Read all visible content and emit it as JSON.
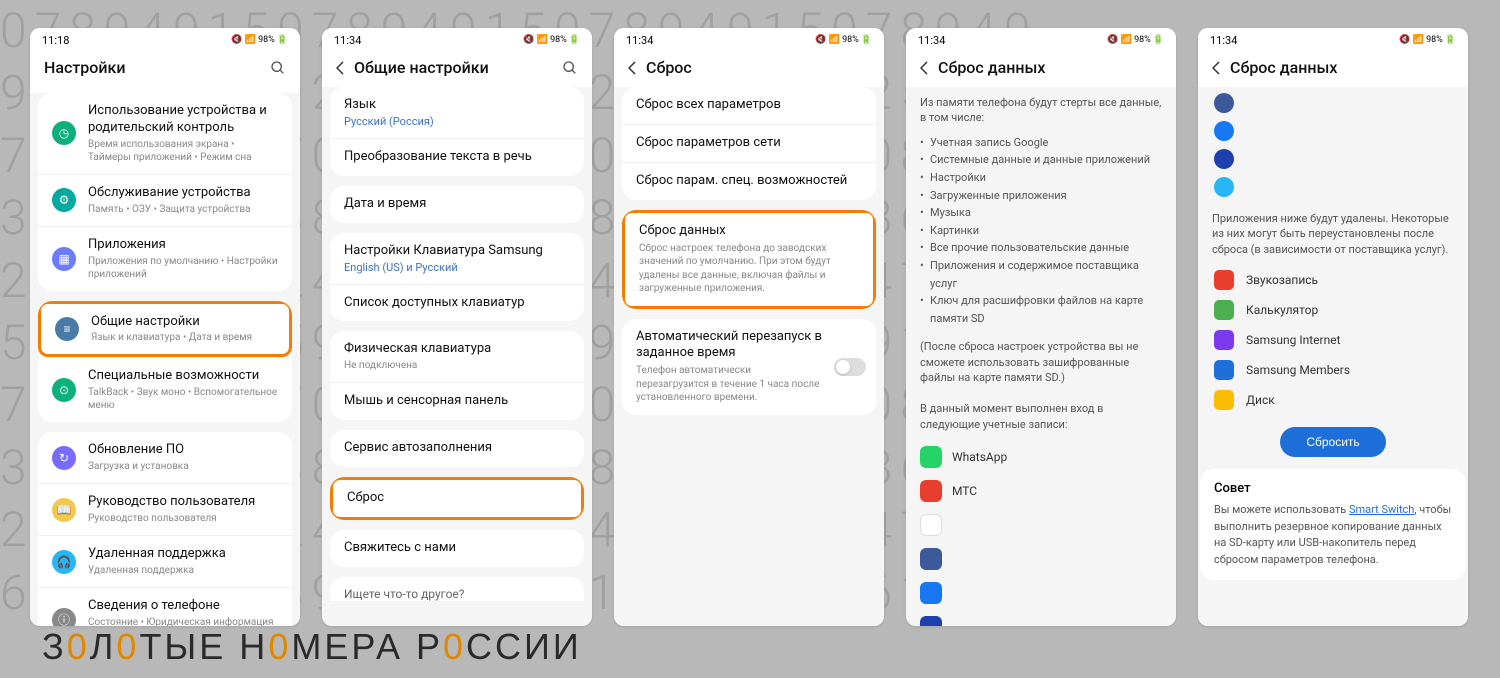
{
  "bg": "0 7 8 9 4 Q 1 5\n9 2 5 7 4 3\n7 0 8 4 2 1\n3 8 6 1 9 5\n2 4 7 0 3 8\n5 9 1 6 2 4",
  "brand": "ЗОЛОТЫЕ НОМЕРА РОССИИ",
  "screen1": {
    "time": "11:18",
    "battery": "98%",
    "title": "Настройки",
    "items": [
      {
        "icon_bg": "#0bb07b",
        "glyph": "◷",
        "title": "Использование устройства и родительский контроль",
        "sub": "Время использования экрана • Таймеры приложений • Режим сна"
      },
      {
        "icon_bg": "#00a99d",
        "glyph": "⚙",
        "title": "Обслуживание устройства",
        "sub": "Память • ОЗУ • Защита устройства"
      },
      {
        "icon_bg": "#6b7cff",
        "glyph": "▦",
        "title": "Приложения",
        "sub": "Приложения по умолчанию • Настройки приложений"
      },
      {
        "icon_bg": "#4a7ba6",
        "glyph": "≡",
        "title": "Общие настройки",
        "sub": "Язык и клавиатура • Дата и время",
        "hl": true
      },
      {
        "icon_bg": "#0bb07b",
        "glyph": "⊙",
        "title": "Специальные возможности",
        "sub": "TalkBack • Звук моно • Вспомогательное меню"
      },
      {
        "icon_bg": "#7a6bff",
        "glyph": "↻",
        "title": "Обновление ПО",
        "sub": "Загрузка и установка"
      },
      {
        "icon_bg": "#f2c94c",
        "glyph": "📖",
        "title": "Руководство пользователя",
        "sub": "Руководство пользователя"
      },
      {
        "icon_bg": "#29b6f6",
        "glyph": "🎧",
        "title": "Удаленная поддержка",
        "sub": "Удаленная поддержка"
      },
      {
        "icon_bg": "#888",
        "glyph": "ⓘ",
        "title": "Сведения о телефоне",
        "sub": "Состояние • Юридическая информация • Имя телефона"
      }
    ]
  },
  "screen2": {
    "time": "11:34",
    "battery": "98%",
    "title": "Общие настройки",
    "g1": [
      {
        "title": "Язык",
        "value": "Русский (Россия)"
      },
      {
        "title": "Преобразование текста в речь"
      }
    ],
    "g2": [
      {
        "title": "Дата и время"
      }
    ],
    "g3": [
      {
        "title": "Настройки Клавиатура Samsung",
        "value": "English (US) и Русский"
      },
      {
        "title": "Список доступных клавиатур"
      }
    ],
    "g4": [
      {
        "title": "Физическая клавиатура",
        "sub": "Не подключена"
      },
      {
        "title": "Мышь и сенсорная панель"
      }
    ],
    "g5": [
      {
        "title": "Сервис автозаполнения"
      }
    ],
    "g6": [
      {
        "title": "Сброс",
        "hl": true
      }
    ],
    "g7": [
      {
        "title": "Свяжитесь с нами"
      }
    ],
    "footer": "Ищете что-то другое?"
  },
  "screen3": {
    "time": "11:34",
    "battery": "98%",
    "title": "Сброс",
    "g1": [
      {
        "title": "Сброс всех параметров"
      },
      {
        "title": "Сброс параметров сети"
      },
      {
        "title": "Сброс парам. спец. возможностей"
      }
    ],
    "g2": [
      {
        "title": "Сброс данных",
        "desc": "Сброс настроек телефона до заводских значений по умолчанию. При этом будут удалены все данные, включая файлы и загруженные приложения.",
        "hl": true
      }
    ],
    "g3": [
      {
        "title": "Автоматический перезапуск в заданное время",
        "desc": "Телефон автоматически перезагрузится в течение 1 часа после установленного времени.",
        "toggle": true
      }
    ]
  },
  "screen4": {
    "time": "11:34",
    "battery": "98%",
    "title": "Сброс данных",
    "intro": "Из памяти телефона будут стерты все данные, в том числе:",
    "bullets": [
      "Учетная запись Google",
      "Системные данные и данные приложений",
      "Настройки",
      "Загруженные приложения",
      "Музыка",
      "Картинки",
      "Все прочие пользовательские данные",
      "Приложения и содержимое поставщика услуг",
      "Ключ для расшифровки файлов на карте памяти SD"
    ],
    "paren": "(После сброса настроек устройства вы не сможете использовать зашифрованные файлы на карте памяти SD.)",
    "accounts_intro": "В данный момент выполнен вход в следующие учетные записи:",
    "accounts": [
      {
        "bg": "#25d366",
        "label": "WhatsApp"
      },
      {
        "bg": "#e83e2e",
        "label": "МТС"
      },
      {
        "bg": "#fff",
        "label": ""
      },
      {
        "bg": "#3c5a99",
        "label": ""
      },
      {
        "bg": "#1877f2",
        "label": ""
      },
      {
        "bg": "#1e40af",
        "label": ""
      }
    ]
  },
  "screen5": {
    "time": "11:34",
    "battery": "98%",
    "title": "Сброс данных",
    "top_icons": [
      {
        "bg": "#3c5a99"
      },
      {
        "bg": "#1877f2"
      },
      {
        "bg": "#1e40af"
      },
      {
        "bg": "#29b6f6"
      }
    ],
    "apps_intro": "Приложения ниже будут удалены. Некоторые из них могут быть переустановлены после сброса (в зависимости от поставщика услуг).",
    "apps": [
      {
        "bg": "#e83e2e",
        "label": "Звукозапись"
      },
      {
        "bg": "#4caf50",
        "label": "Калькулятор"
      },
      {
        "bg": "#7c3aed",
        "label": "Samsung Internet"
      },
      {
        "bg": "#1e6fd9",
        "label": "Samsung Members"
      },
      {
        "bg": "#fbbc04",
        "label": "Диск"
      }
    ],
    "button": "Сбросить",
    "advice_title": "Совет",
    "advice_text_a": "Вы можете использовать ",
    "advice_link": "Smart Switch",
    "advice_text_b": ", чтобы выполнить резервное копирование данных на SD-карту или USB-накопитель перед сбросом параметров телефона."
  }
}
